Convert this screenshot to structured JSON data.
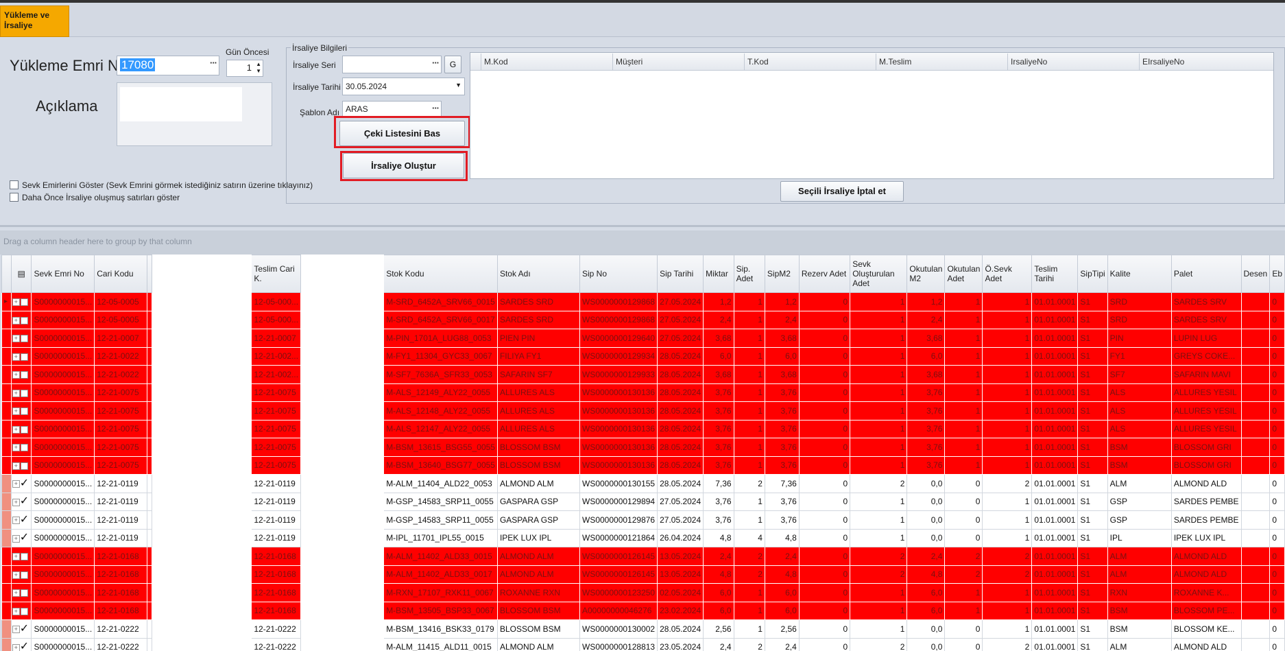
{
  "tab": {
    "label": "Yükleme ve\nİrsaliye"
  },
  "form": {
    "load_order_label": "Yükleme Emri No",
    "load_order_value": "17080",
    "days_before_label": "Gün Öncesi",
    "days_before_value": "1",
    "description_label": "Açıklama",
    "show_dispatch_label": "Sevk Emirlerini Göster (Sevk Emrini görmek istediğiniz satırın üzerine tıklayınız)",
    "show_previous_label": "Daha Önce İrsaliye oluşmuş satırları göster"
  },
  "invoice": {
    "group_title": "İrsaliye Bilgileri",
    "series_label": "İrsaliye Seri",
    "series_value": "",
    "g_button": "G",
    "date_label": "İrsaliye Tarihi",
    "date_value": "30.05.2024",
    "template_label": "Şablon Adı",
    "template_value": "ARAS",
    "print_button": "Çeki Listesini Bas",
    "create_button": "İrsaliye Oluştur",
    "cancel_button": "Seçili İrsaliye İptal et",
    "columns": [
      "M.Kod",
      "Müşteri",
      "T.Kod",
      "M.Teslim",
      "IrsaliyeNo",
      "EIrsaliyeNo"
    ]
  },
  "grid": {
    "group_hint": "Drag a column header here to group by that column",
    "columns": [
      "Sevk Emri No",
      "Cari Kodu",
      "",
      "Teslim Cari K.",
      "",
      "Stok Kodu",
      "Stok Adı",
      "Sip No",
      "Sip Tarihi",
      "Miktar",
      "Sip. Adet",
      "SipM2",
      "Rezerv Adet",
      "Sevk Oluşturulan Adet",
      "Okutulan M2",
      "Okutulan Adet",
      "Ö.Sevk Adet",
      "Teslim Tarihi",
      "SipTipi",
      "Kalite",
      "Palet",
      "Desen",
      "Eb"
    ],
    "rows": [
      {
        "red": true,
        "sevk": "S0000000015...",
        "cari": "12-05-0005",
        "teslim": "12-05-000...",
        "stok": "M-SRD_6452A_SRV66_0015",
        "ad": "SARDES SRD",
        "sip": "WS0000000129868",
        "tarih": "27.05.2024",
        "miktar": "1,2",
        "adet": "1",
        "m2": "1,2",
        "rezerv": "0",
        "olus": "1",
        "okm2": "1,2",
        "okadet": "1",
        "osevk": "1",
        "teslimt": "01.01.0001",
        "tip": "S1",
        "kalite": "SRD",
        "palet": "SARDES SRV",
        "desen": "",
        "eb": "0"
      },
      {
        "red": true,
        "sevk": "S0000000015...",
        "cari": "12-05-0005",
        "teslim": "12-05-000...",
        "stok": "M-SRD_6452A_SRV66_0017",
        "ad": "SARDES SRD",
        "sip": "WS0000000129868",
        "tarih": "27.05.2024",
        "miktar": "2,4",
        "adet": "1",
        "m2": "2,4",
        "rezerv": "0",
        "olus": "1",
        "okm2": "2,4",
        "okadet": "1",
        "osevk": "1",
        "teslimt": "01.01.0001",
        "tip": "S1",
        "kalite": "SRD",
        "palet": "SARDES SRV",
        "desen": "",
        "eb": "0"
      },
      {
        "red": true,
        "sevk": "S0000000015...",
        "cari": "12-21-0007",
        "teslim": "12-21-0007",
        "stok": "M-PIN_1701A_LUG88_0053",
        "ad": "PIEN PIN",
        "sip": "WS0000000129640",
        "tarih": "27.05.2024",
        "miktar": "3,68",
        "adet": "1",
        "m2": "3,68",
        "rezerv": "0",
        "olus": "1",
        "okm2": "3,68",
        "okadet": "1",
        "osevk": "1",
        "teslimt": "01.01.0001",
        "tip": "S1",
        "kalite": "PIN",
        "palet": "LUPIN LUG",
        "desen": "",
        "eb": "0"
      },
      {
        "red": true,
        "sevk": "S0000000015...",
        "cari": "12-21-0022",
        "teslim": "12-21-002...",
        "stok": "M-FY1_11304_GYC33_0067",
        "ad": "FILIYA FY1",
        "sip": "WS0000000129934",
        "tarih": "28.05.2024",
        "miktar": "6,0",
        "adet": "1",
        "m2": "6,0",
        "rezerv": "0",
        "olus": "1",
        "okm2": "6,0",
        "okadet": "1",
        "osevk": "1",
        "teslimt": "01.01.0001",
        "tip": "S1",
        "kalite": "FY1",
        "palet": "GREYS COKE...",
        "desen": "",
        "eb": "0"
      },
      {
        "red": true,
        "sevk": "S0000000015...",
        "cari": "12-21-0022",
        "teslim": "12-21-002...",
        "stok": "M-SF7_7636A_SFR33_0053",
        "ad": "SAFARIN SF7",
        "sip": "WS0000000129933",
        "tarih": "28.05.2024",
        "miktar": "3,68",
        "adet": "1",
        "m2": "3,68",
        "rezerv": "0",
        "olus": "1",
        "okm2": "3,68",
        "okadet": "1",
        "osevk": "1",
        "teslimt": "01.01.0001",
        "tip": "S1",
        "kalite": "SF7",
        "palet": "SAFARIN MAVI",
        "desen": "",
        "eb": "0"
      },
      {
        "red": true,
        "sevk": "S0000000015...",
        "cari": "12-21-0075",
        "teslim": "12-21-0075",
        "stok": "M-ALS_12149_ALY22_0055",
        "ad": "ALLURES ALS",
        "sip": "WS0000000130136",
        "tarih": "28.05.2024",
        "miktar": "3,76",
        "adet": "1",
        "m2": "3,76",
        "rezerv": "0",
        "olus": "1",
        "okm2": "3,76",
        "okadet": "1",
        "osevk": "1",
        "teslimt": "01.01.0001",
        "tip": "S1",
        "kalite": "ALS",
        "palet": "ALLURES YESIL",
        "desen": "",
        "eb": "0"
      },
      {
        "red": true,
        "sevk": "S0000000015...",
        "cari": "12-21-0075",
        "teslim": "12-21-0075",
        "stok": "M-ALS_12148_ALY22_0055",
        "ad": "ALLURES ALS",
        "sip": "WS0000000130136",
        "tarih": "28.05.2024",
        "miktar": "3,76",
        "adet": "1",
        "m2": "3,76",
        "rezerv": "0",
        "olus": "1",
        "okm2": "3,76",
        "okadet": "1",
        "osevk": "1",
        "teslimt": "01.01.0001",
        "tip": "S1",
        "kalite": "ALS",
        "palet": "ALLURES YESIL",
        "desen": "",
        "eb": "0"
      },
      {
        "red": true,
        "sevk": "S0000000015...",
        "cari": "12-21-0075",
        "teslim": "12-21-0075",
        "stok": "M-ALS_12147_ALY22_0055",
        "ad": "ALLURES ALS",
        "sip": "WS0000000130136",
        "tarih": "28.05.2024",
        "miktar": "3,76",
        "adet": "1",
        "m2": "3,76",
        "rezerv": "0",
        "olus": "1",
        "okm2": "3,76",
        "okadet": "1",
        "osevk": "1",
        "teslimt": "01.01.0001",
        "tip": "S1",
        "kalite": "ALS",
        "palet": "ALLURES YESIL",
        "desen": "",
        "eb": "0"
      },
      {
        "red": true,
        "sevk": "S0000000015...",
        "cari": "12-21-0075",
        "teslim": "12-21-0075",
        "stok": "M-BSM_13615_BSG55_0055",
        "ad": "BLOSSOM BSM",
        "sip": "WS0000000130136",
        "tarih": "28.05.2024",
        "miktar": "3,76",
        "adet": "1",
        "m2": "3,76",
        "rezerv": "0",
        "olus": "1",
        "okm2": "3,76",
        "okadet": "1",
        "osevk": "1",
        "teslimt": "01.01.0001",
        "tip": "S1",
        "kalite": "BSM",
        "palet": "BLOSSOM GRI",
        "desen": "",
        "eb": "0"
      },
      {
        "red": true,
        "sevk": "S0000000015...",
        "cari": "12-21-0075",
        "teslim": "12-21-0075",
        "stok": "M-BSM_13640_BSG77_0055",
        "ad": "BLOSSOM BSM",
        "sip": "WS0000000130136",
        "tarih": "28.05.2024",
        "miktar": "3,76",
        "adet": "1",
        "m2": "3,76",
        "rezerv": "0",
        "olus": "1",
        "okm2": "3,76",
        "okadet": "1",
        "osevk": "1",
        "teslimt": "01.01.0001",
        "tip": "S1",
        "kalite": "BSM",
        "palet": "BLOSSOM GRI",
        "desen": "",
        "eb": "0"
      },
      {
        "red": false,
        "sevk": "S0000000015...",
        "cari": "12-21-0119",
        "teslim": "12-21-0119",
        "stok": "M-ALM_11404_ALD22_0053",
        "ad": "ALMOND ALM",
        "sip": "WS0000000130155",
        "tarih": "28.05.2024",
        "miktar": "7,36",
        "adet": "2",
        "m2": "7,36",
        "rezerv": "0",
        "olus": "2",
        "okm2": "0,0",
        "okadet": "0",
        "osevk": "2",
        "teslimt": "01.01.0001",
        "tip": "S1",
        "kalite": "ALM",
        "palet": "ALMOND ALD",
        "desen": "",
        "eb": "0"
      },
      {
        "red": false,
        "sevk": "S0000000015...",
        "cari": "12-21-0119",
        "teslim": "12-21-0119",
        "stok": "M-GSP_14583_SRP11_0055",
        "ad": "GASPARA GSP",
        "sip": "WS0000000129894",
        "tarih": "27.05.2024",
        "miktar": "3,76",
        "adet": "1",
        "m2": "3,76",
        "rezerv": "0",
        "olus": "1",
        "okm2": "0,0",
        "okadet": "0",
        "osevk": "1",
        "teslimt": "01.01.0001",
        "tip": "S1",
        "kalite": "GSP",
        "palet": "SARDES PEMBE",
        "desen": "",
        "eb": "0"
      },
      {
        "red": false,
        "sevk": "S0000000015...",
        "cari": "12-21-0119",
        "teslim": "12-21-0119",
        "stok": "M-GSP_14583_SRP11_0055",
        "ad": "GASPARA GSP",
        "sip": "WS0000000129876",
        "tarih": "27.05.2024",
        "miktar": "3,76",
        "adet": "1",
        "m2": "3,76",
        "rezerv": "0",
        "olus": "1",
        "okm2": "0,0",
        "okadet": "0",
        "osevk": "1",
        "teslimt": "01.01.0001",
        "tip": "S1",
        "kalite": "GSP",
        "palet": "SARDES PEMBE",
        "desen": "",
        "eb": "0"
      },
      {
        "red": false,
        "sevk": "S0000000015...",
        "cari": "12-21-0119",
        "teslim": "12-21-0119",
        "stok": "M-IPL_11701_IPL55_0015",
        "ad": "IPEK LUX IPL",
        "sip": "WS0000000121864",
        "tarih": "26.04.2024",
        "miktar": "4,8",
        "adet": "4",
        "m2": "4,8",
        "rezerv": "0",
        "olus": "1",
        "okm2": "0,0",
        "okadet": "0",
        "osevk": "1",
        "teslimt": "01.01.0001",
        "tip": "S1",
        "kalite": "IPL",
        "palet": "IPEK LUX IPL",
        "desen": "",
        "eb": "0"
      },
      {
        "red": true,
        "sevk": "S0000000015...",
        "cari": "12-21-0168",
        "teslim": "12-21-0168",
        "stok": "M-ALM_11402_ALD33_0015",
        "ad": "ALMOND ALM",
        "sip": "WS0000000126145",
        "tarih": "13.05.2024",
        "miktar": "2,4",
        "adet": "2",
        "m2": "2,4",
        "rezerv": "0",
        "olus": "2",
        "okm2": "2,4",
        "okadet": "2",
        "osevk": "2",
        "teslimt": "01.01.0001",
        "tip": "S1",
        "kalite": "ALM",
        "palet": "ALMOND ALD",
        "desen": "",
        "eb": "0"
      },
      {
        "red": true,
        "sevk": "S0000000015...",
        "cari": "12-21-0168",
        "teslim": "12-21-0168",
        "stok": "M-ALM_11402_ALD33_0017",
        "ad": "ALMOND ALM",
        "sip": "WS0000000126145",
        "tarih": "13.05.2024",
        "miktar": "4,8",
        "adet": "2",
        "m2": "4,8",
        "rezerv": "0",
        "olus": "2",
        "okm2": "4,8",
        "okadet": "2",
        "osevk": "2",
        "teslimt": "01.01.0001",
        "tip": "S1",
        "kalite": "ALM",
        "palet": "ALMOND ALD",
        "desen": "",
        "eb": "0"
      },
      {
        "red": true,
        "sevk": "S0000000015...",
        "cari": "12-21-0168",
        "teslim": "12-21-0168",
        "stok": "M-RXN_17107_RXK11_0067",
        "ad": "ROXANNE RXN",
        "sip": "WS0000000123250",
        "tarih": "02.05.2024",
        "miktar": "6,0",
        "adet": "1",
        "m2": "6,0",
        "rezerv": "0",
        "olus": "1",
        "okm2": "6,0",
        "okadet": "1",
        "osevk": "1",
        "teslimt": "01.01.0001",
        "tip": "S1",
        "kalite": "RXN",
        "palet": "ROXANNE K...",
        "desen": "",
        "eb": "0"
      },
      {
        "red": true,
        "sevk": "S0000000015...",
        "cari": "12-21-0168",
        "teslim": "12-21-0168",
        "stok": "M-BSM_13505_BSP33_0067",
        "ad": "BLOSSOM BSM",
        "sip": "A00000000046276",
        "tarih": "23.02.2024",
        "miktar": "6,0",
        "adet": "1",
        "m2": "6,0",
        "rezerv": "0",
        "olus": "1",
        "okm2": "6,0",
        "okadet": "1",
        "osevk": "1",
        "teslimt": "01.01.0001",
        "tip": "S1",
        "kalite": "BSM",
        "palet": "BLOSSOM PE...",
        "desen": "",
        "eb": "0"
      },
      {
        "red": false,
        "sevk": "S0000000015...",
        "cari": "12-21-0222",
        "teslim": "12-21-0222",
        "stok": "M-BSM_13416_BSK33_0179",
        "ad": "BLOSSOM BSM",
        "sip": "WS0000000130002",
        "tarih": "28.05.2024",
        "miktar": "2,56",
        "adet": "1",
        "m2": "2,56",
        "rezerv": "0",
        "olus": "1",
        "okm2": "0,0",
        "okadet": "0",
        "osevk": "1",
        "teslimt": "01.01.0001",
        "tip": "S1",
        "kalite": "BSM",
        "palet": "BLOSSOM KE...",
        "desen": "",
        "eb": "0"
      },
      {
        "red": false,
        "sevk": "S0000000015...",
        "cari": "12-21-0222",
        "teslim": "12-21-0222",
        "stok": "M-ALM_11415_ALD11_0015",
        "ad": "ALMOND ALM",
        "sip": "WS0000000128813",
        "tarih": "23.05.2024",
        "miktar": "2,4",
        "adet": "2",
        "m2": "2,4",
        "rezerv": "0",
        "olus": "2",
        "okm2": "0,0",
        "okadet": "0",
        "osevk": "2",
        "teslimt": "01.01.0001",
        "tip": "S1",
        "kalite": "ALM",
        "palet": "ALMOND ALD",
        "desen": "",
        "eb": "0"
      }
    ]
  }
}
